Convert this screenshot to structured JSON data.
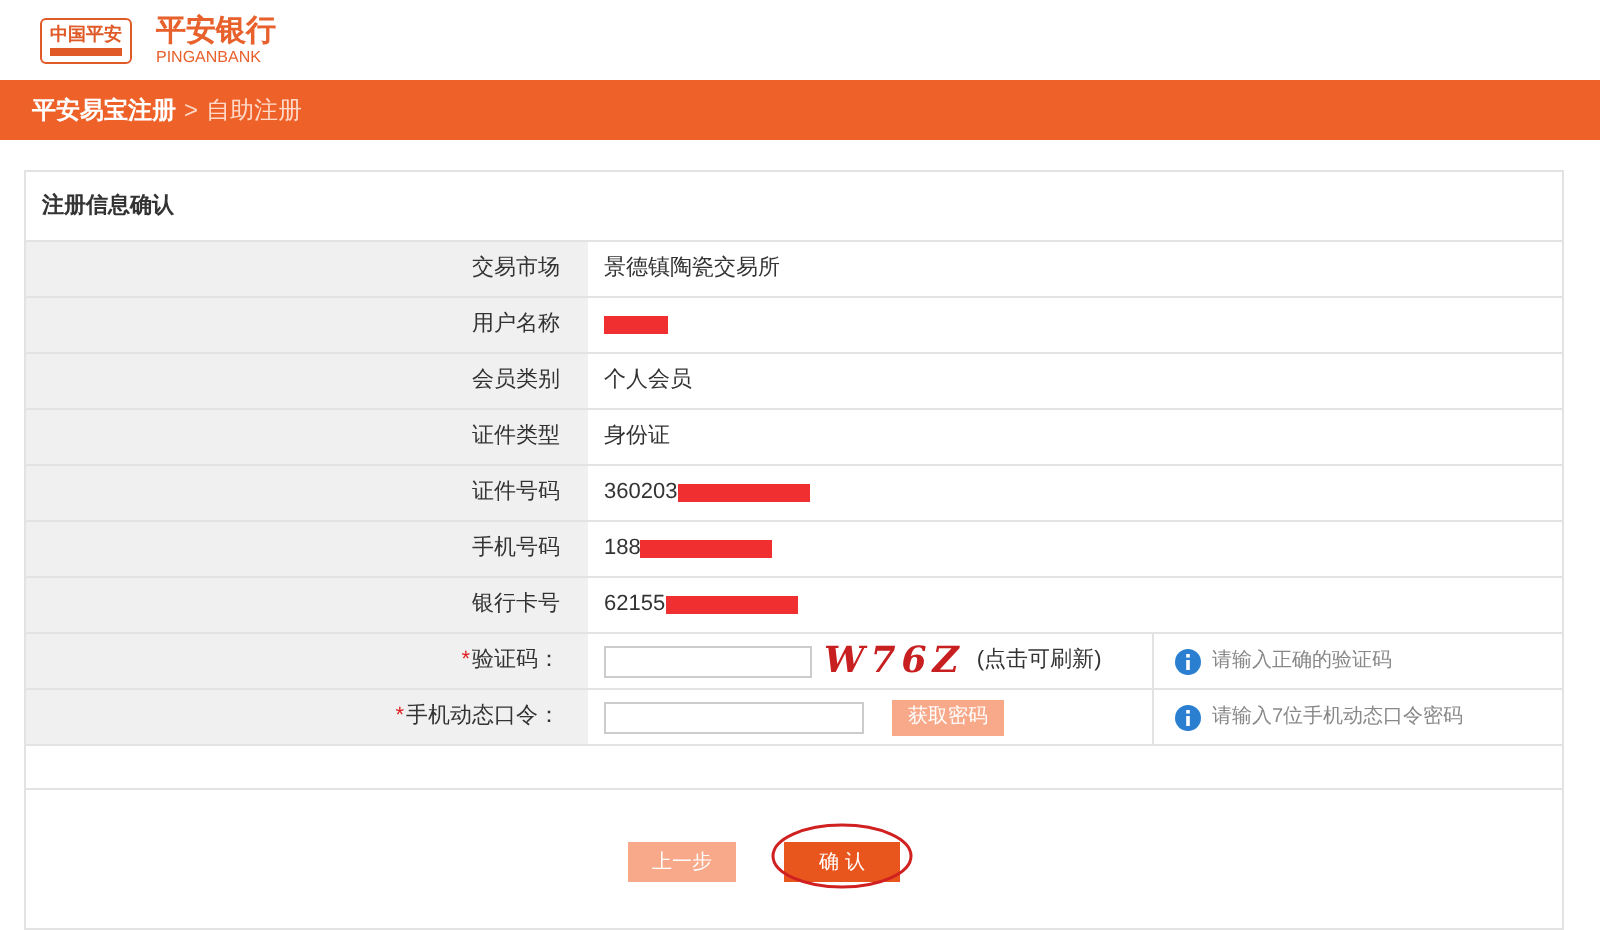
{
  "logo": {
    "badge": "中国平安",
    "name": "平安银行",
    "subtitle": "PINGANBANK"
  },
  "breadcrumb": {
    "current": "平安易宝注册",
    "separator": ">",
    "page": "自助注册"
  },
  "panel": {
    "title": "注册信息确认"
  },
  "info_rows": [
    {
      "label": "交易市场",
      "value": "景德镇陶瓷交易所",
      "redacted": false
    },
    {
      "label": "用户名称",
      "value": "",
      "redacted": true
    },
    {
      "label": "会员类别",
      "value": "个人会员",
      "redacted": false
    },
    {
      "label": "证件类型",
      "value": "身份证",
      "redacted": false
    },
    {
      "label": "证件号码",
      "value": "360203",
      "redacted": true
    },
    {
      "label": "手机号码",
      "value": "188",
      "redacted": true
    },
    {
      "label": "银行卡号",
      "value": "62155",
      "redacted": true
    }
  ],
  "form_rows": [
    {
      "kind": "captcha",
      "required_mark": "*",
      "label": "验证码：",
      "captcha": "W76Z",
      "refresh": "(点击可刷新)",
      "hint": "请输入正确的验证码"
    },
    {
      "kind": "sms",
      "required_mark": "*",
      "label": "手机动态口令：",
      "button": "获取密码",
      "button_disabled": true,
      "hint": "请输入7位手机动态口令密码"
    }
  ],
  "buttons": [
    {
      "label": "上一步",
      "primary": false,
      "circled": false
    },
    {
      "label": "确 认",
      "primary": true,
      "circled": true
    }
  ]
}
